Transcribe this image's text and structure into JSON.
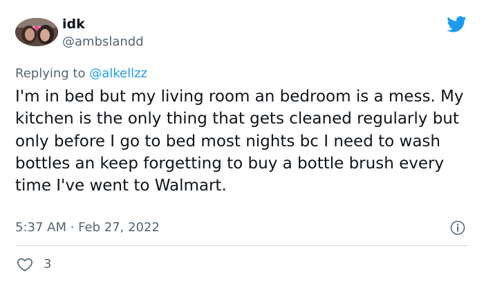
{
  "author": {
    "display_name": "idk",
    "handle": "@ambslandd"
  },
  "icons": {
    "brand": "twitter-bird-icon",
    "info": "info-icon",
    "like": "heart-icon"
  },
  "colors": {
    "brand": "#1d9bf0",
    "text": "#0f1419",
    "secondary": "#536471",
    "divider": "#cfd9de"
  },
  "reply": {
    "prefix": "Replying to",
    "mention": "@alkellzz"
  },
  "tweet": {
    "text": "I'm in bed but my living room an bedroom is a mess. My kitchen is the only thing that gets cleaned regularly but only before I go to bed most nights bc I need to wash bottles an keep forgetting to buy a bottle brush every time I've went to Walmart.",
    "timestamp": "5:37 AM · Feb 27, 2022"
  },
  "stats": {
    "likes": "3"
  }
}
